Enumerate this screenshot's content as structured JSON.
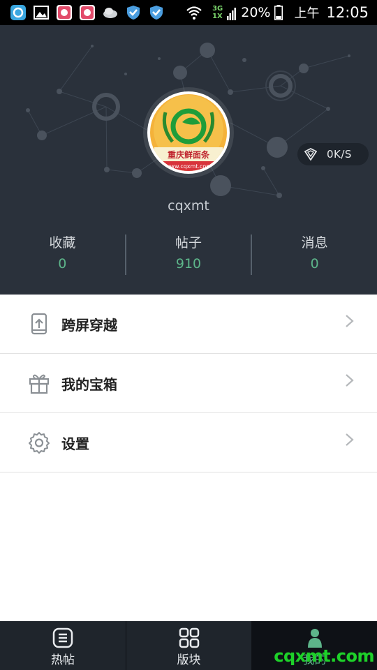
{
  "status_bar": {
    "battery": "20%",
    "am_pm": "上午",
    "time": "12:05",
    "network_top": "3G",
    "network_bottom": "1X"
  },
  "profile": {
    "avatar_text_top": "重庆鲜面条",
    "avatar_text_url": "www.cqxmt.com",
    "username": "cqxmt",
    "speed": "0K/S"
  },
  "stats": [
    {
      "label": "收藏",
      "value": "0"
    },
    {
      "label": "帖子",
      "value": "910"
    },
    {
      "label": "消息",
      "value": "0"
    }
  ],
  "menu": [
    {
      "label": "跨屏穿越",
      "icon": "cross-screen-icon"
    },
    {
      "label": "我的宝箱",
      "icon": "gift-box-icon"
    },
    {
      "label": "设置",
      "icon": "settings-gear-icon"
    }
  ],
  "nav": [
    {
      "label": "热帖",
      "icon": "list-icon"
    },
    {
      "label": "版块",
      "icon": "grid-icon"
    },
    {
      "label": "我的",
      "icon": "person-icon"
    }
  ],
  "watermark": "cqxmt.com",
  "colors": {
    "header_bg": "#2a313b",
    "accent_green": "#5db58a",
    "nav_bg": "#1f252c"
  }
}
